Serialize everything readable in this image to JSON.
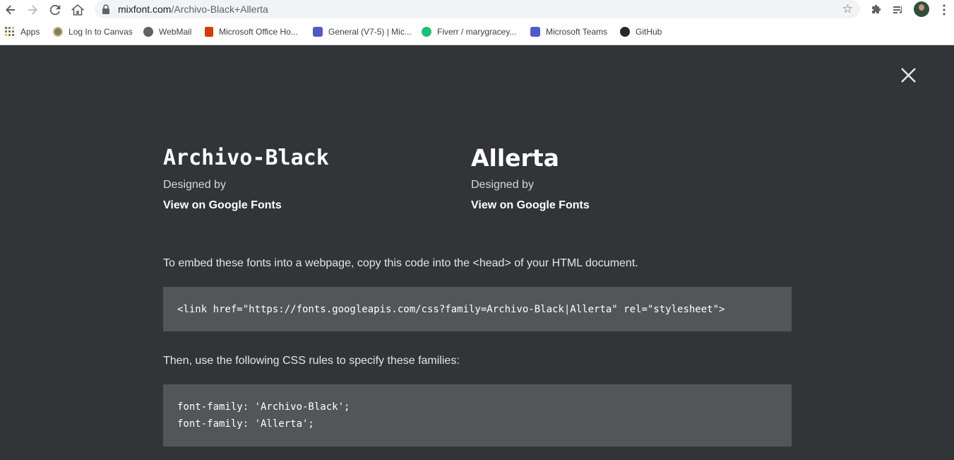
{
  "browser": {
    "url_domain": "mixfont.com",
    "url_path": "/Archivo-Black+Allerta",
    "bookmarks": [
      {
        "label": "Apps",
        "icon": "apps-grid-icon"
      },
      {
        "label": "Log In to Canvas",
        "icon": "canvas-icon"
      },
      {
        "label": "WebMail",
        "icon": "globe-icon"
      },
      {
        "label": "Microsoft Office Ho...",
        "icon": "office-icon"
      },
      {
        "label": "General (V7-5) | Mic...",
        "icon": "teams-icon"
      },
      {
        "label": "Fiverr / marygracey...",
        "icon": "fiverr-icon"
      },
      {
        "label": "Microsoft Teams",
        "icon": "teams-icon"
      },
      {
        "label": "GitHub",
        "icon": "github-icon"
      }
    ]
  },
  "fonts": [
    {
      "name": "Archivo-Black",
      "designed_by": "Designed by",
      "link": "View on Google Fonts"
    },
    {
      "name": "Allerta",
      "designed_by": "Designed by",
      "link": "View on Google Fonts"
    }
  ],
  "embed": {
    "instruction": "To embed these fonts into a webpage, copy this code into the <head> of your HTML document.",
    "code": "<link href=\"https://fonts.googleapis.com/css?family=Archivo-Black|Allerta\" rel=\"stylesheet\">"
  },
  "css": {
    "instruction": "Then, use the following CSS rules to specify these families:",
    "lines": [
      "font-family: 'Archivo-Black';",
      "font-family: 'Allerta';"
    ]
  },
  "colors": {
    "page_bg": "#323538",
    "code_bg": "#545556"
  }
}
